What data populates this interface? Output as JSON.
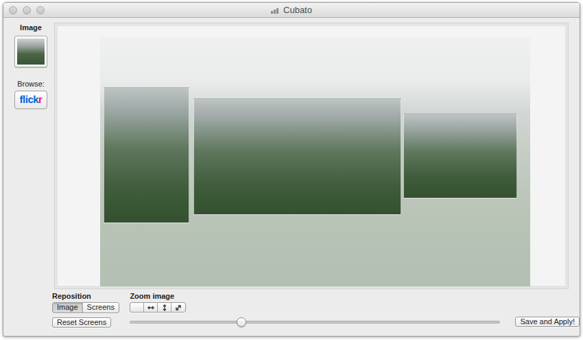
{
  "window": {
    "title": "Cubato"
  },
  "sidebar": {
    "image_label": "Image",
    "browse_label": "Browse:",
    "flickr_logo": [
      {
        "text": "flick",
        "color": "#0063dc"
      },
      {
        "text": "r",
        "color": "#ff0084"
      }
    ]
  },
  "reposition": {
    "label": "Reposition",
    "modes": [
      {
        "label": "Image",
        "selected": true
      },
      {
        "label": "Screens",
        "selected": false
      }
    ],
    "reset_button": "Reset Screens"
  },
  "zoom": {
    "label": "Zoom image",
    "modes": [
      {
        "kind": "none",
        "selected": false
      },
      {
        "kind": "horizontal",
        "selected": false
      },
      {
        "kind": "vertical",
        "selected": false
      },
      {
        "kind": "both",
        "selected": false
      }
    ],
    "level": 0.3
  },
  "save_button": "Save and Apply!"
}
